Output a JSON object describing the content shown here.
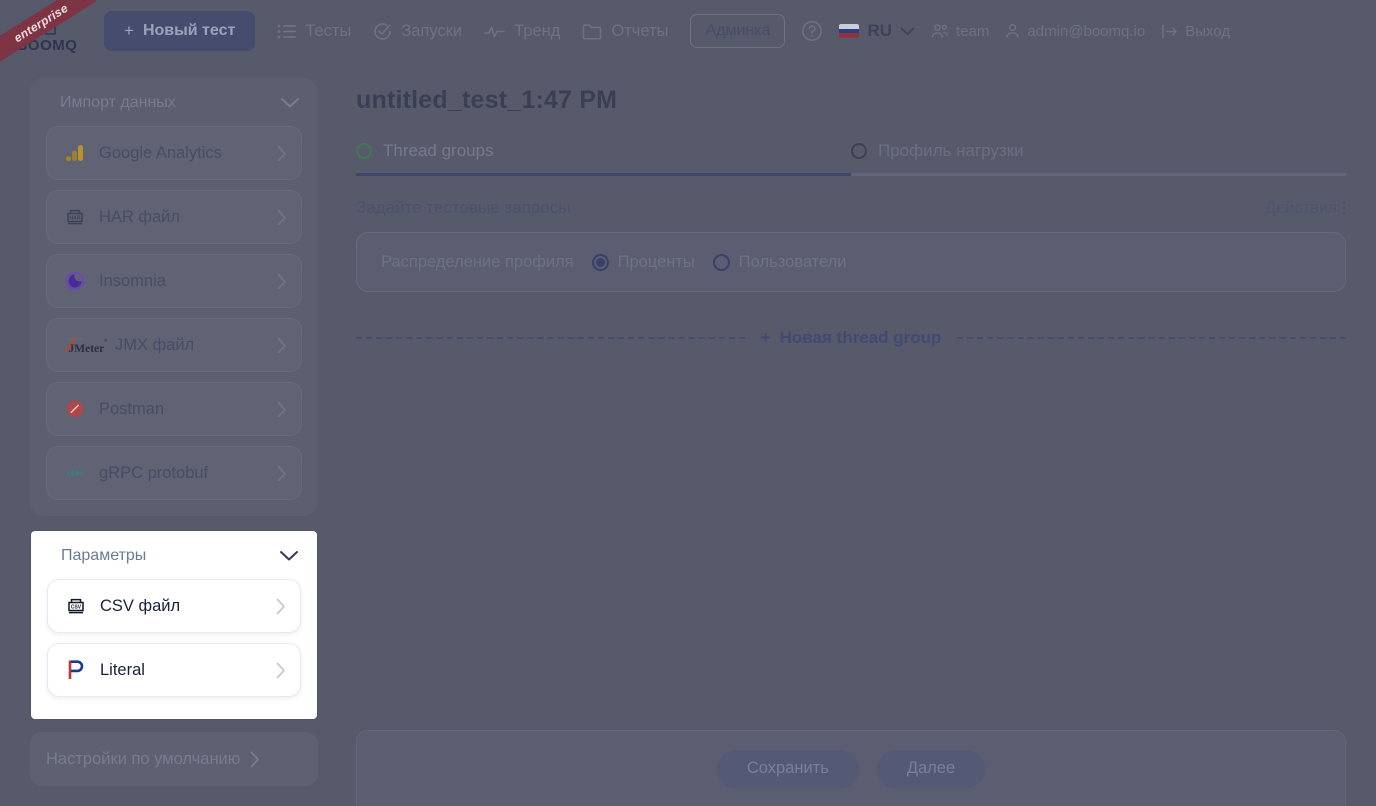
{
  "topbar": {
    "logo_text": "BOOMQ",
    "ribbon_label": "enterprise",
    "new_test_label": "Новый тест",
    "new_test_plus": "+",
    "nav": [
      {
        "label": "Тесты",
        "icon": "list-icon"
      },
      {
        "label": "Запуски",
        "icon": "check-circle-icon"
      },
      {
        "label": "Тренд",
        "icon": "pulse-icon"
      },
      {
        "label": "Отчеты",
        "icon": "folder-icon"
      }
    ],
    "admin_label": "Админка",
    "help_icon": "question-circle-icon",
    "language": "RU",
    "language_flag": "ru-flag-icon",
    "team_label": "team",
    "account_label": "admin@boomq.io",
    "logout_label": "Выход"
  },
  "sidebar": {
    "import": {
      "title": "Импорт данных",
      "items": [
        {
          "label": "Google Analytics",
          "icon": "google-analytics-icon"
        },
        {
          "label": "HAR файл",
          "icon": "har-file-icon"
        },
        {
          "label": "Insomnia",
          "icon": "insomnia-icon"
        },
        {
          "label": "JMX файл",
          "icon": "jmeter-icon"
        },
        {
          "label": "Postman",
          "icon": "postman-icon"
        },
        {
          "label": "gRPC protobuf",
          "icon": "grpc-icon"
        }
      ]
    },
    "params": {
      "title": "Параметры",
      "items": [
        {
          "label": "CSV файл",
          "icon": "csv-file-icon"
        },
        {
          "label": "Literal",
          "icon": "literal-p-icon"
        }
      ]
    },
    "defaults_label": "Настройки по умолчанию"
  },
  "main": {
    "title": "untitled_test_1:47 PM",
    "tabs": [
      {
        "label": "Thread groups",
        "active": true
      },
      {
        "label": "Профиль нагрузки",
        "active": false
      }
    ],
    "section_title": "Задайте тестовые запросы",
    "actions_label": "Действия",
    "distribution": {
      "label": "Распределение профиля",
      "options": [
        {
          "label": "Проценты",
          "selected": true
        },
        {
          "label": "Пользователи",
          "selected": false
        }
      ]
    },
    "add_thread_group_label": "Новая thread group",
    "add_thread_group_plus": "+"
  },
  "footer": {
    "save_label": "Сохранить",
    "next_label": "Далее"
  },
  "colors": {
    "overlay": "#565a6b",
    "panel": "#5b5f70",
    "accent": "#3f4669",
    "highlight_bg": "#ffffff",
    "ribbon": "#7d3545"
  }
}
